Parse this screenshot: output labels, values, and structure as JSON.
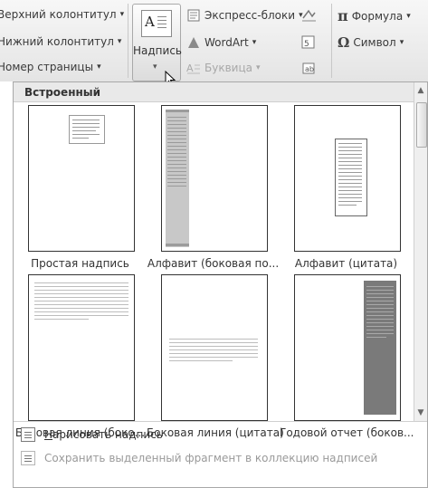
{
  "ribbon": {
    "header_items": [
      {
        "label": "Верхний колонтитул",
        "caret": "▾"
      },
      {
        "label": "Нижний колонтитул",
        "caret": "▾"
      },
      {
        "label": "Номер страницы",
        "caret": "▾"
      }
    ],
    "text_box_button": {
      "label": "Надпись",
      "icon_letter": "A",
      "caret": "▾"
    },
    "insert_items": [
      {
        "label": "Экспресс-блоки",
        "caret": "▾",
        "icon": "quick-parts-icon"
      },
      {
        "label": "WordArt",
        "caret": "▾",
        "icon": "wordart-icon"
      },
      {
        "label": "Буквица",
        "caret": "▾",
        "icon": "dropcap-icon",
        "disabled": true
      }
    ],
    "formula": {
      "label": "Формула",
      "glyph": "π",
      "caret": "▾"
    },
    "symbol": {
      "label": "Символ",
      "glyph": "Ω",
      "caret": "▾"
    }
  },
  "gallery": {
    "section_title": "Встроенный",
    "tiles": [
      {
        "label": "Простая надпись"
      },
      {
        "label": "Алфавит (боковая по..."
      },
      {
        "label": "Алфавит (цитата)"
      },
      {
        "label": "Боковая линия (боко..."
      },
      {
        "label": "Боковая линия (цитата)"
      },
      {
        "label": "Годовой отчет (боков..."
      }
    ]
  },
  "menu": {
    "draw": {
      "label": "Нарисовать надпись",
      "access_key": "Н"
    },
    "save": {
      "label": "Сохранить выделенный фрагмент в коллекцию надписей",
      "disabled": true
    }
  }
}
